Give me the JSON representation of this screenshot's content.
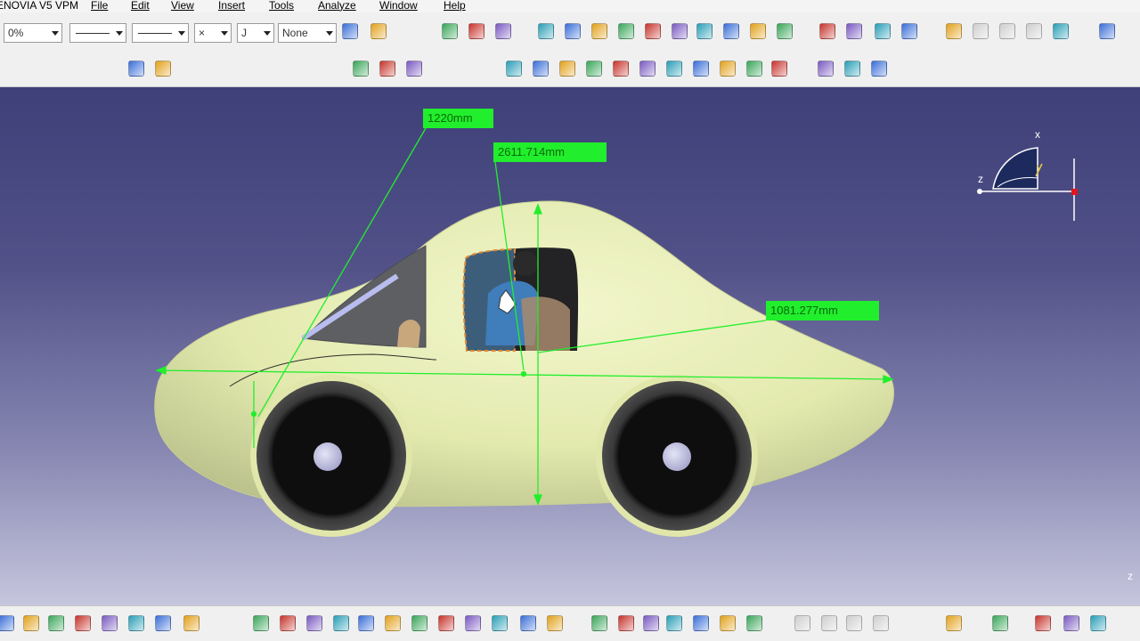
{
  "menubar": {
    "app_title": "ENOVIA V5 VPM",
    "items": [
      "File",
      "Edit",
      "View",
      "Insert",
      "Tools",
      "Analyze",
      "Window",
      "Help"
    ]
  },
  "graphic_properties": {
    "transparency": "0%",
    "line_type": "solid",
    "line_thickness": "solid",
    "point_style": "×",
    "layer_short": "J",
    "layer": "None"
  },
  "measurements": {
    "height": "1220mm",
    "wheelbase": "2611.714mm",
    "rear": "1081.277mm"
  },
  "compass": {
    "x_label": "x",
    "y_label": "y",
    "z_label": "z"
  },
  "colors": {
    "body": "#e8eeb6",
    "background_top": "#3f3f79",
    "background_bottom": "#c6c6de",
    "measure_green": "#21ee2c",
    "tire": "#1e1e1e",
    "hub": "#c9c9ea"
  },
  "icons": {
    "top_row": [
      "brush-icon",
      "paint-icon",
      "assembly-icon",
      "assembly-2-icon",
      "assembly-3-icon",
      "link-icon",
      "part-icon",
      "product-icon",
      "plane-icon",
      "tools-icon",
      "pencil-icon",
      "catalog-icon",
      "constraint-icon",
      "update-icon",
      "explode-icon",
      "clash-icon",
      "section-icon",
      "distance-icon",
      "compass-icon",
      "spec-icon",
      "gray-1-icon",
      "gray-2-icon",
      "gray-3-icon",
      "save-mgmt-icon",
      "exit-icon"
    ],
    "second_row": [
      "fly-icon",
      "walk-icon",
      "scene-1-icon",
      "scene-2-icon",
      "tree-icon",
      "gear-1-icon",
      "gear-2-icon",
      "gear-3-icon",
      "move-1-icon",
      "move-2-icon",
      "move-3-icon",
      "move-4-icon",
      "text-icon",
      "flag-icon",
      "replace-icon",
      "multi-icon",
      "view-1-icon",
      "view-2-icon",
      "view-3-icon"
    ],
    "bottom_row": [
      "save-icon",
      "print-icon",
      "cut-icon",
      "copy-icon",
      "paste-icon",
      "undo-icon",
      "redo-icon",
      "whats-this-icon",
      "fly-mode-icon",
      "fit-all-icon",
      "pan-icon",
      "rotate-icon",
      "zoom-in-icon",
      "zoom-out-icon",
      "normal-view-icon",
      "iso-view-icon",
      "views-icon",
      "shading-icon",
      "hide-show-icon",
      "swap-icon",
      "formula-icon",
      "comment-icon",
      "light-icon",
      "table-icon",
      "tree-expand-icon",
      "analysis-icon",
      "measure-icon",
      "gray-4-icon",
      "gray-5-icon",
      "gray-6-icon",
      "gray-7-icon",
      "refresh-icon",
      "camera-icon",
      "screen-icon",
      "capture-icon",
      "bottle-icon"
    ]
  }
}
